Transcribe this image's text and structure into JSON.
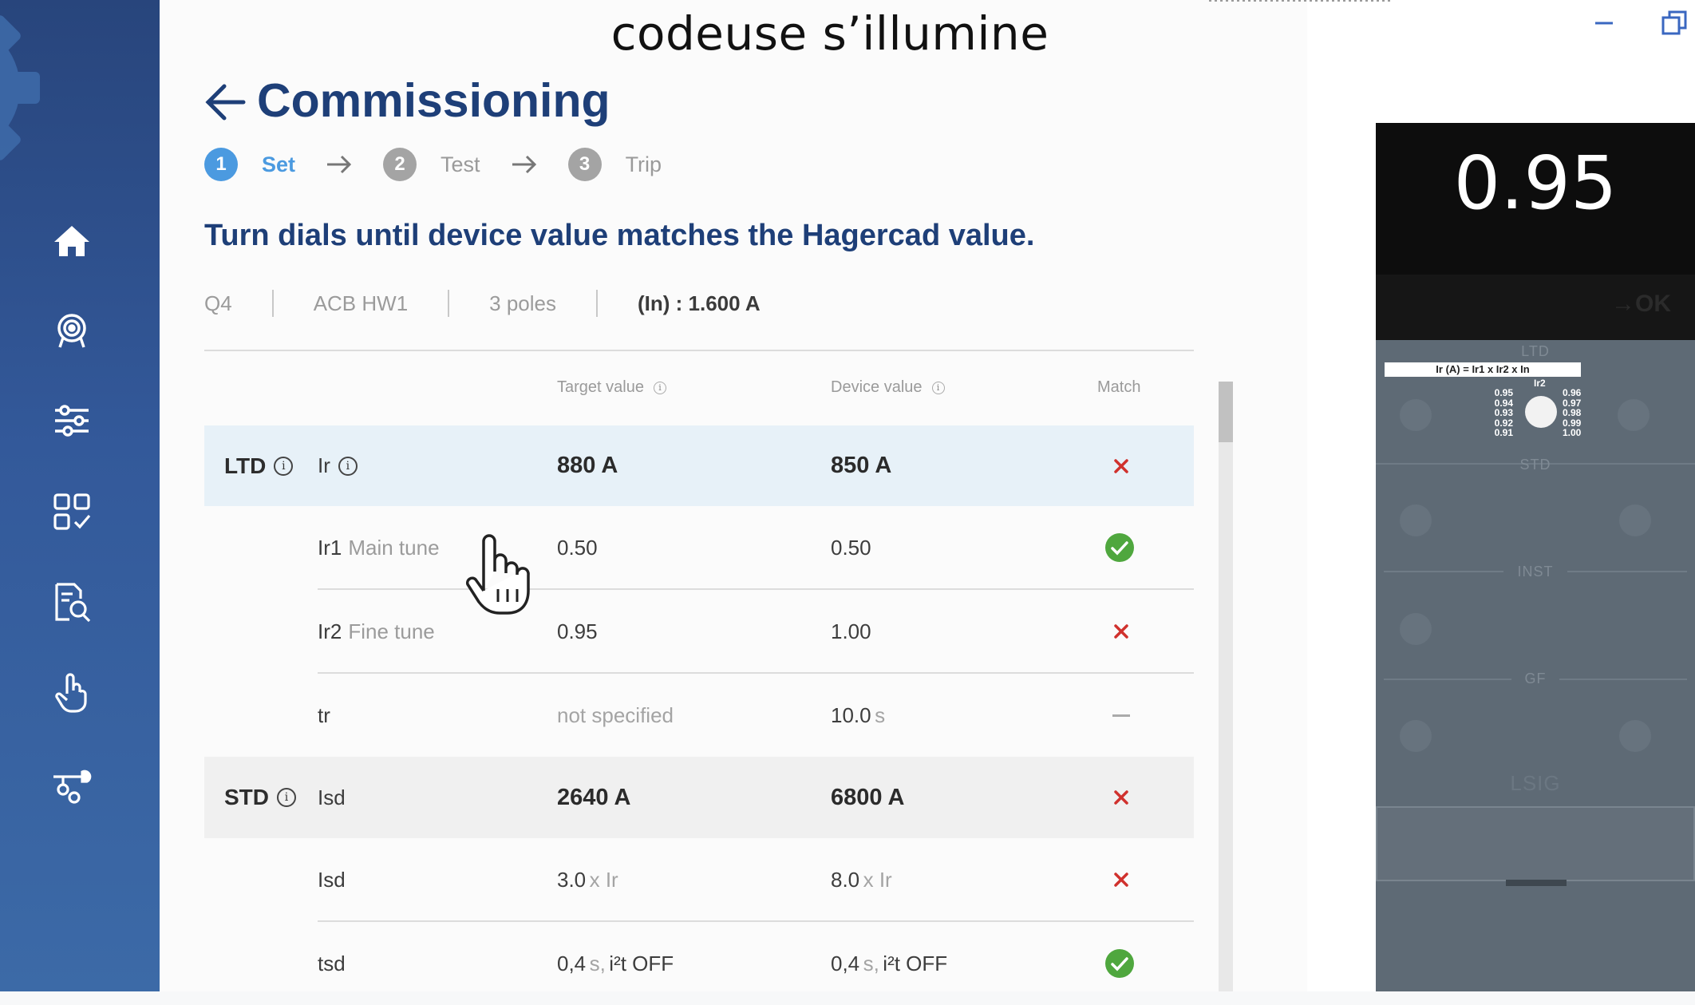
{
  "caption": "codeuse s’illumine",
  "page": {
    "title": "Commissioning",
    "instruction": "Turn dials until device value matches the Hagercad value."
  },
  "steps": [
    {
      "num": "1",
      "label": "Set"
    },
    {
      "num": "2",
      "label": "Test"
    },
    {
      "num": "3",
      "label": "Trip"
    }
  ],
  "device_info": {
    "name": "Q4",
    "type": "ACB HW1",
    "poles": "3 poles",
    "rating": "(In) : 1.600 A"
  },
  "table": {
    "headers": {
      "target": "Target value",
      "device": "Device value",
      "match": "Match"
    },
    "groups": [
      {
        "name": "LTD",
        "param": "Ir",
        "target": "880 A",
        "device": "850 A",
        "match": "no",
        "rows": [
          {
            "param": "Ir1",
            "sub": "Main tune",
            "target": "0.50",
            "target_unit": "",
            "device": "0.50",
            "device_unit": "",
            "match": "yes"
          },
          {
            "param": "Ir2",
            "sub": "Fine tune",
            "target": "0.95",
            "target_unit": "",
            "device": "1.00",
            "device_unit": "",
            "match": "no"
          },
          {
            "param": "tr",
            "sub": "",
            "target": "not specified",
            "target_unit": "",
            "device": "10.0",
            "device_unit": "s",
            "match": "none"
          }
        ]
      },
      {
        "name": "STD",
        "param": "Isd",
        "target": "2640 A",
        "device": "6800 A",
        "match": "no",
        "rows": [
          {
            "param": "Isd",
            "sub": "",
            "target": "3.0",
            "target_unit": "x Ir",
            "device": "8.0",
            "device_unit": "x Ir",
            "match": "no"
          },
          {
            "param": "tsd",
            "sub": "",
            "target": "0,4",
            "target_unit": "s,",
            "target_extra": "i²t OFF",
            "device": "0,4",
            "device_unit": "s,",
            "device_extra": "i²t OFF",
            "match": "yes"
          }
        ]
      }
    ]
  },
  "device_panel": {
    "reading": "0.95",
    "ok_label": "→OK",
    "formula": "Ir (A) = Ir1 x Ir2 x In",
    "dial_label": "Ir2",
    "dial_left": [
      "0.95",
      "0.94",
      "0.93",
      "0.92",
      "0.91"
    ],
    "dial_right": [
      "0.96",
      "0.97",
      "0.98",
      "0.99",
      "1.00"
    ],
    "sections": [
      "LTD",
      "STD",
      "INST",
      "GF",
      "LSIG"
    ]
  },
  "colors": {
    "sidebar": "#33599a",
    "title": "#1e3f78",
    "accent": "#4b9ae0",
    "mismatch": "#d0312d",
    "match": "#4fa73e"
  },
  "nav_icons": [
    "home-icon",
    "target-icon",
    "sliders-icon",
    "grid-check-icon",
    "document-search-icon",
    "touch-icon",
    "tools-icon"
  ]
}
